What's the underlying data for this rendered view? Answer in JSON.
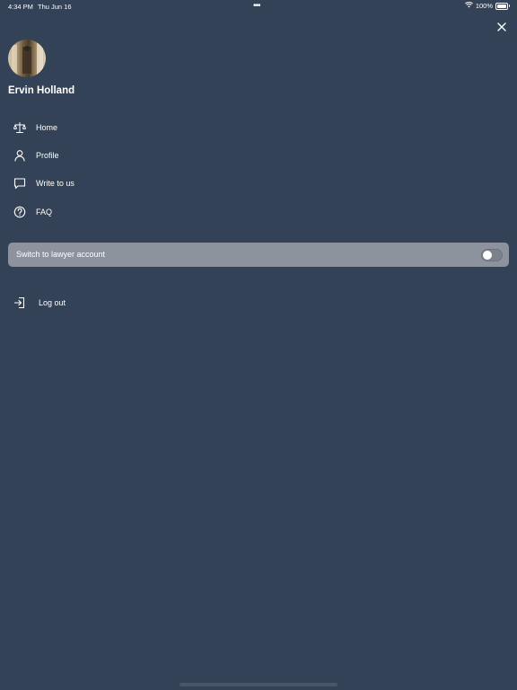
{
  "status_bar": {
    "time": "4:34 PM",
    "date": "Thu Jun 16",
    "dots": "•••",
    "battery_percent": "100%",
    "icons": [
      "wifi-icon",
      "battery-icon"
    ]
  },
  "drawer": {
    "close_icon": "close-icon",
    "user_name": "Ervin Holland",
    "menu": [
      {
        "label": "Home",
        "icon": "scales-icon"
      },
      {
        "label": "Profile",
        "icon": "person-icon"
      },
      {
        "label": "Write to us",
        "icon": "chat-bubble-icon"
      },
      {
        "label": "FAQ",
        "icon": "question-circle-icon"
      }
    ],
    "switch": {
      "label": "Switch to lawyer account",
      "on": false
    },
    "logout": {
      "label": "Log out",
      "icon": "logout-icon"
    }
  },
  "colors": {
    "background": "#344257",
    "switch_row": "#8c939d",
    "text": "#ffffff"
  }
}
